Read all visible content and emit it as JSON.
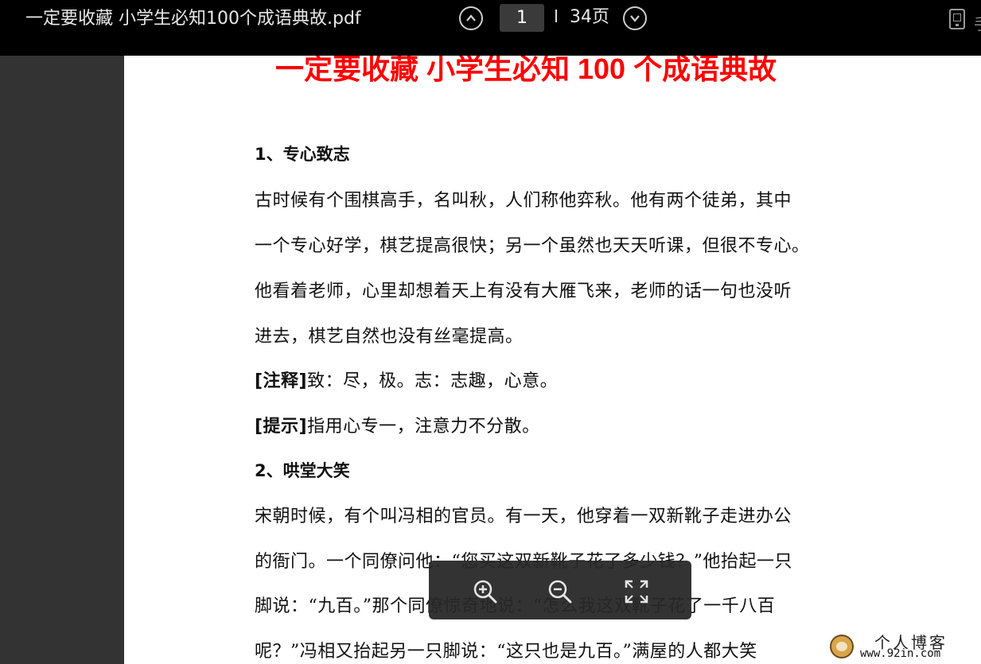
{
  "toolbar": {
    "file_title": "一定要收藏 小学生必知100个成语典故.pdf",
    "current_page": "1",
    "total_pages": "34页",
    "edge_text": "手"
  },
  "document": {
    "title": "一定要收藏 小学生必知 100 个成语典故",
    "sections": [
      {
        "heading": "1、专心致志",
        "lines": [
          "古时候有个围棋高手，名叫秋，人们称他弈秋。他有两个徒弟，其中",
          "一个专心好学，棋艺提高很快；另一个虽然也天天听课，但很不专心。",
          "他看着老师，心里却想着天上有没有大雁飞来，老师的话一句也没听",
          "进去，棋艺自然也没有丝毫提高。"
        ],
        "note_label": "[注释]",
        "note_text": "致：尽，极。志：志趣，心意。",
        "tip_label": "[提示]",
        "tip_text": "指用心专一，注意力不分散。"
      },
      {
        "heading": "2、哄堂大笑",
        "lines": [
          "宋朝时候，有个叫冯相的官员。有一天，他穿着一双新靴子走进办公",
          "的衙门。一个同僚问他：“您买这双新靴子花了多少钱？”他抬起一只",
          "脚说：“九百。”那个同僚惊奇地说：“怎么我这双靴子花了一千八百",
          "呢？”冯相又抬起另一只脚说：“这只也是九百。”满屋的人都大笑"
        ]
      }
    ]
  },
  "watermark": {
    "title": "个人博客",
    "url": "www.92in.com"
  },
  "icons": {
    "prev": "chevron-up-circle-icon",
    "next": "chevron-down-circle-icon",
    "device": "mobile-device-icon",
    "zoom_in": "zoom-in-icon",
    "zoom_out": "zoom-out-icon",
    "fit": "fullscreen-icon"
  }
}
